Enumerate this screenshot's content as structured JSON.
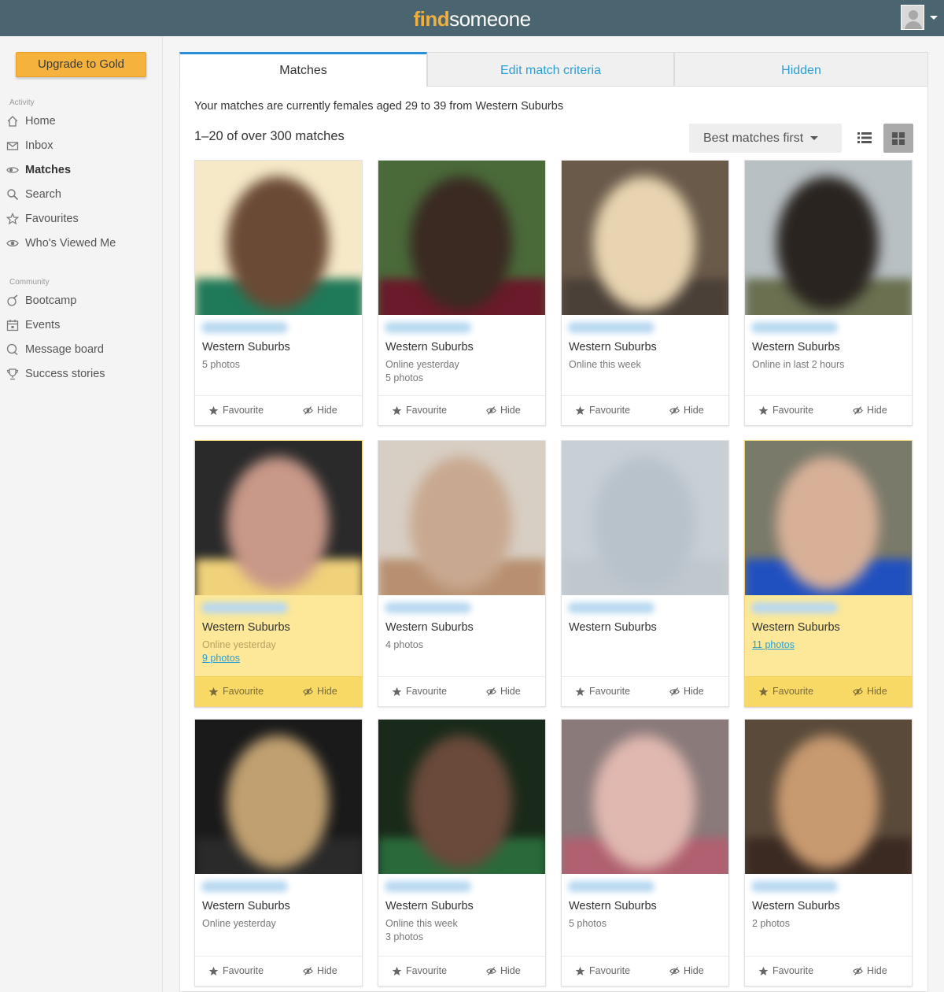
{
  "header": {
    "logo_find": "find",
    "logo_someone": "someone"
  },
  "sidebar": {
    "upgrade_label": "Upgrade to Gold",
    "activity_label": "Activity",
    "community_label": "Community",
    "activity_items": [
      {
        "label": "Home",
        "icon": "home-icon"
      },
      {
        "label": "Inbox",
        "icon": "inbox-icon"
      },
      {
        "label": "Matches",
        "icon": "matches-icon"
      },
      {
        "label": "Search",
        "icon": "search-icon"
      },
      {
        "label": "Favourites",
        "icon": "star-icon"
      },
      {
        "label": "Who's Viewed Me",
        "icon": "eye-icon"
      }
    ],
    "community_items": [
      {
        "label": "Bootcamp",
        "icon": "bootcamp-icon"
      },
      {
        "label": "Events",
        "icon": "calendar-icon"
      },
      {
        "label": "Message board",
        "icon": "chat-icon"
      },
      {
        "label": "Success stories",
        "icon": "trophy-icon"
      }
    ]
  },
  "tabs": {
    "matches": "Matches",
    "edit_criteria": "Edit match criteria",
    "hidden": "Hidden"
  },
  "main": {
    "criteria_text": "Your matches are currently females aged 29 to 39 from Western Suburbs",
    "count_text": "1–20 of over 300 matches",
    "sort_label": "Best matches first"
  },
  "actions": {
    "favourite": "Favourite",
    "hide": "Hide"
  },
  "colors": {
    "topbar": "#4a6470",
    "accent_gold": "#f5b33e",
    "link_blue": "#2a9fd6",
    "gold_card": "#fce898"
  },
  "cards": [
    {
      "location": "Western Suburbs",
      "lines": [
        "5 photos"
      ],
      "gold": false
    },
    {
      "location": "Western Suburbs",
      "lines": [
        "Online yesterday",
        "5 photos"
      ],
      "gold": false
    },
    {
      "location": "Western Suburbs",
      "lines": [
        "Online this week"
      ],
      "gold": false
    },
    {
      "location": "Western Suburbs",
      "lines": [
        "Online in last 2 hours"
      ],
      "gold": false
    },
    {
      "location": "Western Suburbs",
      "lines": [
        "Online yesterday"
      ],
      "link": "9 photos",
      "gold": true
    },
    {
      "location": "Western Suburbs",
      "lines": [
        "4 photos"
      ],
      "gold": false
    },
    {
      "location": "Western Suburbs",
      "lines": [],
      "gold": false
    },
    {
      "location": "Western Suburbs",
      "lines": [],
      "link": "11 photos",
      "gold": true
    },
    {
      "location": "Western Suburbs",
      "lines": [
        "Online yesterday"
      ],
      "gold": false
    },
    {
      "location": "Western Suburbs",
      "lines": [
        "Online this week",
        "3 photos"
      ],
      "gold": false
    },
    {
      "location": "Western Suburbs",
      "lines": [
        "5 photos"
      ],
      "gold": false
    },
    {
      "location": "Western Suburbs",
      "lines": [
        "2 photos"
      ],
      "gold": false
    }
  ]
}
